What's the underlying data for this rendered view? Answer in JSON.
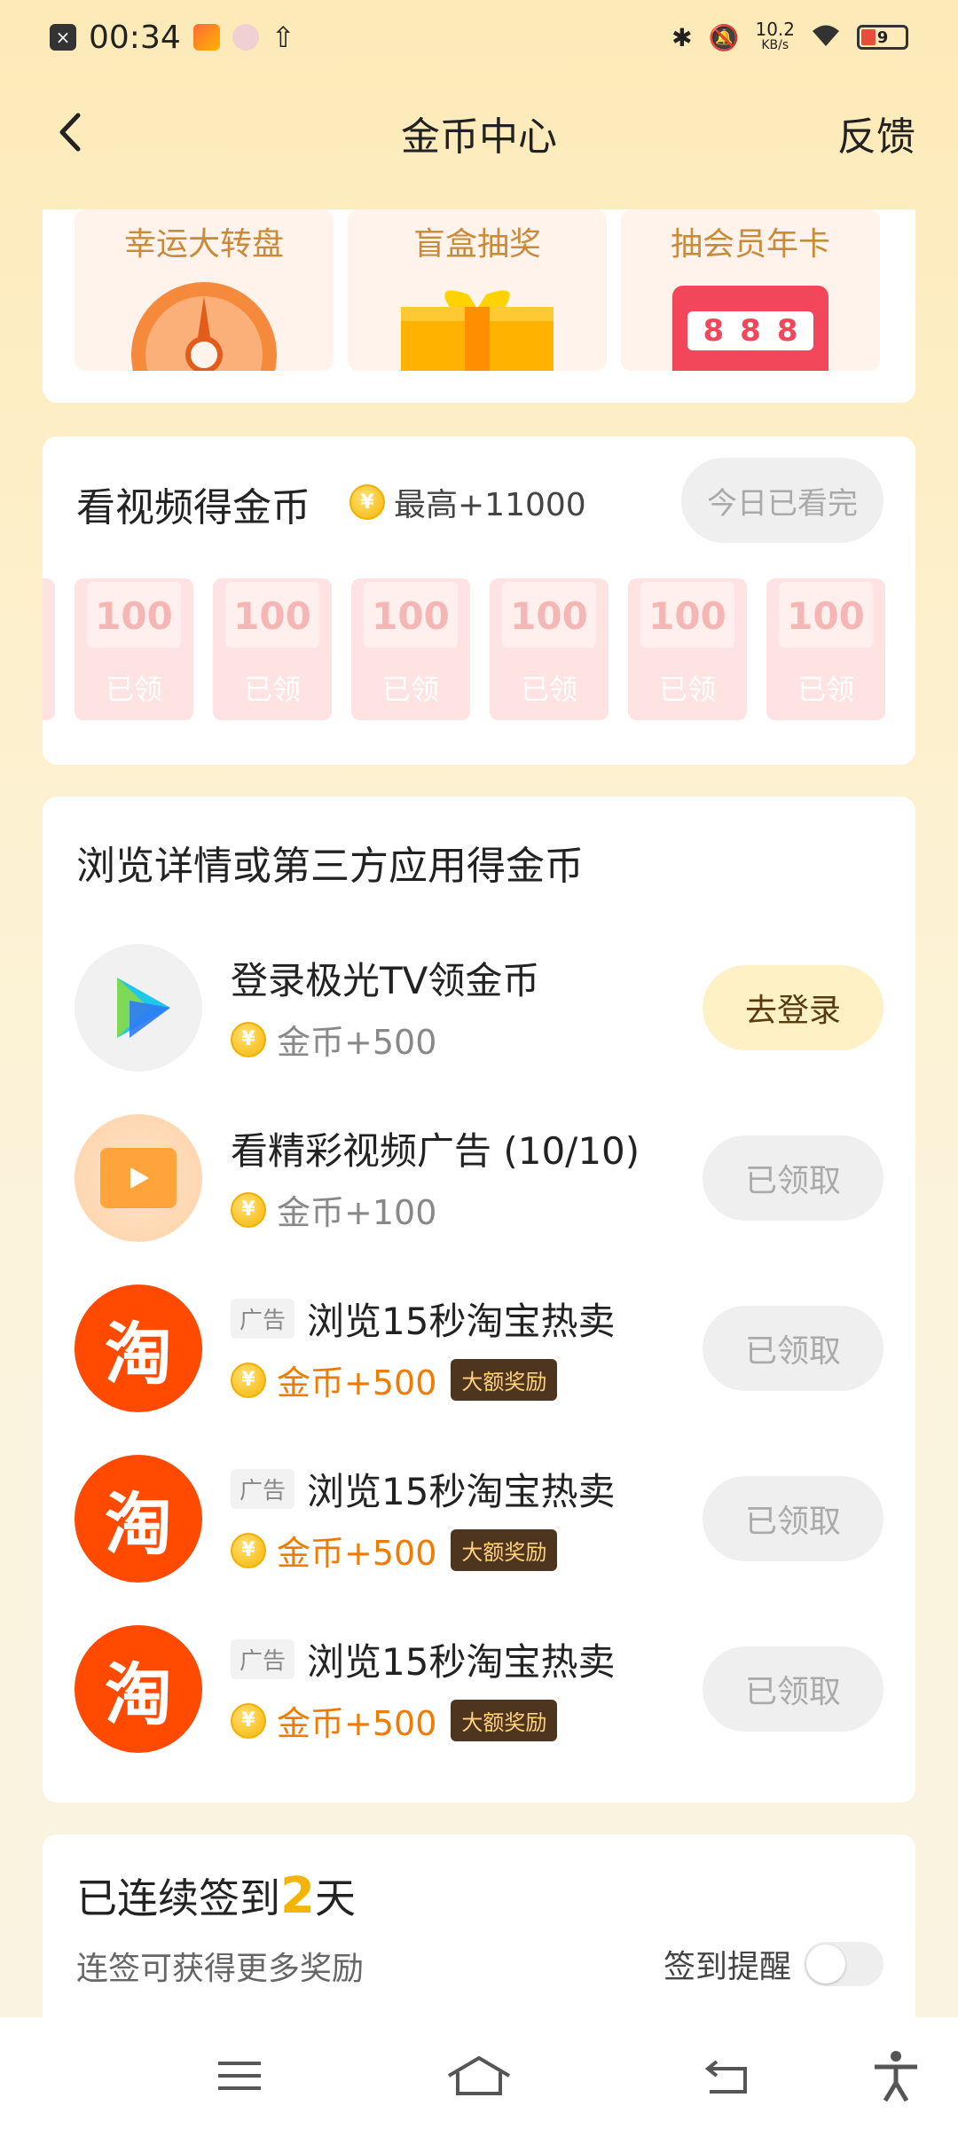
{
  "status": {
    "time": "00:34",
    "speed_top": "10.2",
    "speed_unit": "KB/s",
    "battery": "9"
  },
  "header": {
    "title": "金币中心",
    "right": "反馈"
  },
  "lottery": {
    "tiles": [
      {
        "label": "幸运大转盘"
      },
      {
        "label": "盲盒抽奖"
      },
      {
        "label": "抽会员年卡",
        "slot": "888"
      }
    ]
  },
  "video": {
    "title": "看视频得金币",
    "coin_symbol": "¥",
    "max": "最高+11000",
    "button": "今日已看完",
    "envelopes": [
      {
        "amount": "100",
        "label": "已领"
      },
      {
        "amount": "100",
        "label": "已领"
      },
      {
        "amount": "100",
        "label": "已领"
      },
      {
        "amount": "100",
        "label": "已领"
      },
      {
        "amount": "100",
        "label": "已领"
      },
      {
        "amount": "100",
        "label": "已领"
      }
    ]
  },
  "tasks": {
    "title": "浏览详情或第三方应用得金币",
    "items": [
      {
        "name": "登录极光TV领金币",
        "reward": "金币+500",
        "button": "去登录"
      },
      {
        "name": "看精彩视频广告 (10/10)",
        "reward": "金币+100",
        "button": "已领取"
      },
      {
        "ad": "广告",
        "name": "浏览15秒淘宝热卖",
        "reward": "金币+500",
        "badge": "大额奖励",
        "button": "已领取",
        "logo_char": "淘"
      },
      {
        "ad": "广告",
        "name": "浏览15秒淘宝热卖",
        "reward": "金币+500",
        "badge": "大额奖励",
        "button": "已领取",
        "logo_char": "淘"
      },
      {
        "ad": "广告",
        "name": "浏览15秒淘宝热卖",
        "reward": "金币+500",
        "badge": "大额奖励",
        "button": "已领取",
        "logo_char": "淘"
      }
    ]
  },
  "signin": {
    "prefix": "已连续签到",
    "days": "2",
    "suffix": "天",
    "subtitle": "连签可获得更多奖励",
    "remind": "签到提醒",
    "remind_on": false
  },
  "colors": {
    "accent": "#f5b400",
    "reward_orange": "#f07b00",
    "taobao": "#ff4a00"
  }
}
